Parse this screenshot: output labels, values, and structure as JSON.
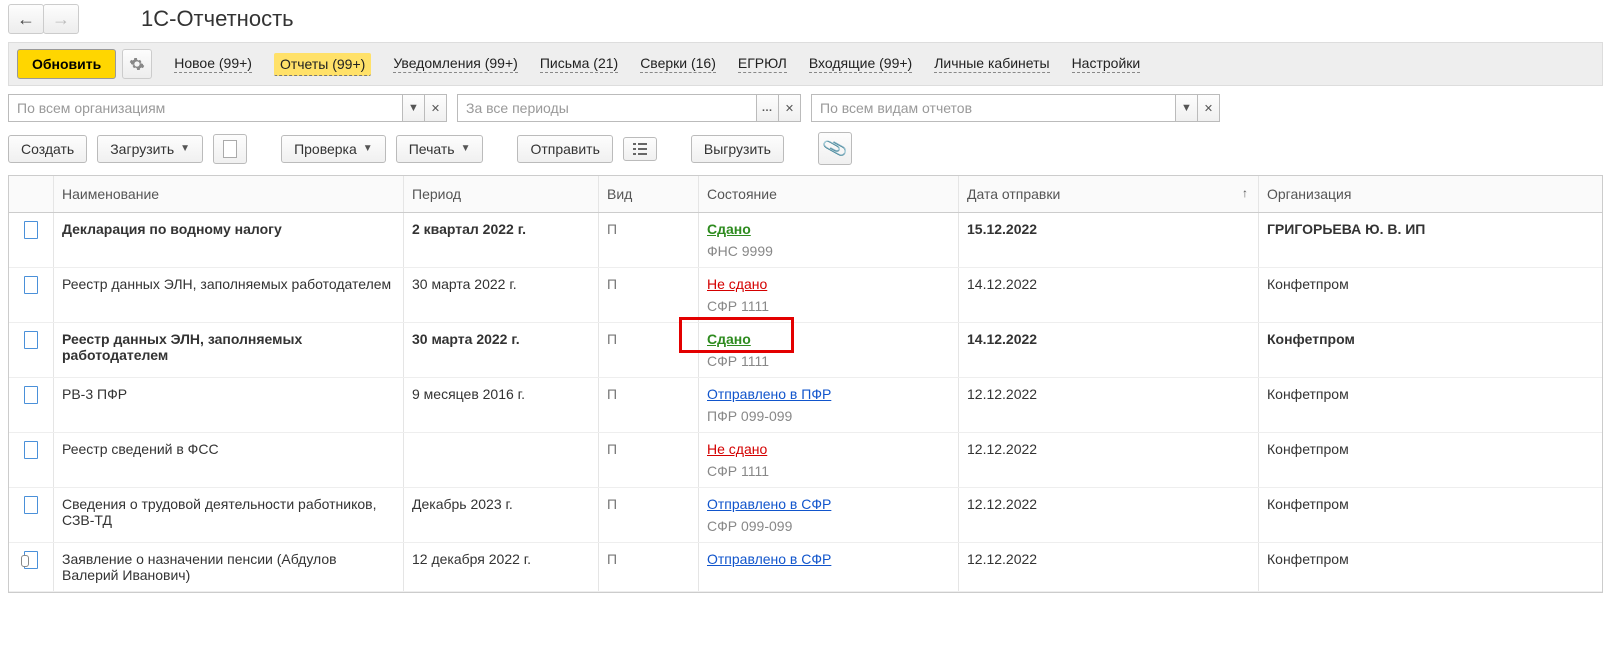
{
  "header": {
    "title": "1С-Отчетность"
  },
  "toolbar": {
    "refresh": "Обновить",
    "links": {
      "new": "Новое (99+)",
      "reports": "Отчеты (99+)",
      "notifications": "Уведомления (99+)",
      "letters": "Письма (21)",
      "reconcil": "Сверки (16)",
      "egrul": "ЕГРЮЛ",
      "incoming": "Входящие (99+)",
      "cabinets": "Личные кабинеты",
      "settings": "Настройки"
    }
  },
  "filters": {
    "org_placeholder": "По всем организациям",
    "period_placeholder": "За все периоды",
    "type_placeholder": "По всем видам отчетов"
  },
  "actions": {
    "create": "Создать",
    "load": "Загрузить",
    "check": "Проверка",
    "print": "Печать",
    "send": "Отправить",
    "export": "Выгрузить"
  },
  "columns": {
    "name": "Наименование",
    "period": "Период",
    "type": "Вид",
    "status": "Состояние",
    "date": "Дата отправки",
    "org": "Организация"
  },
  "rows": [
    {
      "bold": true,
      "name": "Декларация по водному налогу",
      "period": "2 квартал 2022 г.",
      "type": "П",
      "status": "Сдано",
      "status_class": "green",
      "sub": "ФНС 9999",
      "date": "15.12.2022",
      "org": "ГРИГОРЬЕВА Ю. В. ИП",
      "icon": "doc"
    },
    {
      "bold": false,
      "name": "Реестр данных ЭЛН, заполняемых работодателем",
      "period": "30 марта 2022 г.",
      "type": "П",
      "status": "Не сдано",
      "status_class": "red",
      "sub": "СФР 1111",
      "date": "14.12.2022",
      "org": "Конфетпром",
      "icon": "doc"
    },
    {
      "bold": true,
      "highlight": true,
      "name": "Реестр данных ЭЛН, заполняемых работодателем",
      "period": "30 марта 2022 г.",
      "type": "П",
      "status": "Сдано",
      "status_class": "green",
      "sub": "СФР 1111",
      "date": "14.12.2022",
      "org": "Конфетпром",
      "icon": "doc"
    },
    {
      "bold": false,
      "name": "РВ-3 ПФР",
      "period": "9 месяцев 2016 г.",
      "type": "П",
      "status": "Отправлено в ПФР",
      "status_class": "blue",
      "sub": "ПФР 099-099",
      "date": "12.12.2022",
      "org": "Конфетпром",
      "icon": "doc"
    },
    {
      "bold": false,
      "name": "Реестр сведений в ФСС",
      "period": "",
      "type": "П",
      "status": "Не сдано",
      "status_class": "red",
      "sub": "СФР 1111",
      "date": "12.12.2022",
      "org": "Конфетпром",
      "icon": "doc"
    },
    {
      "bold": false,
      "name": "Сведения о трудовой деятельности работников, СЗВ-ТД",
      "period": "Декабрь 2023 г.",
      "type": "П",
      "status": "Отправлено в СФР",
      "status_class": "blue",
      "sub": "СФР 099-099",
      "date": "12.12.2022",
      "org": "Конфетпром",
      "icon": "doc"
    },
    {
      "bold": false,
      "name": "Заявление о назначении пенсии (Абдулов Валерий Иванович)",
      "period": "12 декабря 2022 г.",
      "type": "П",
      "status": "Отправлено в СФР",
      "status_class": "blue",
      "sub": "",
      "date": "12.12.2022",
      "org": "Конфетпром",
      "icon": "clip"
    }
  ]
}
